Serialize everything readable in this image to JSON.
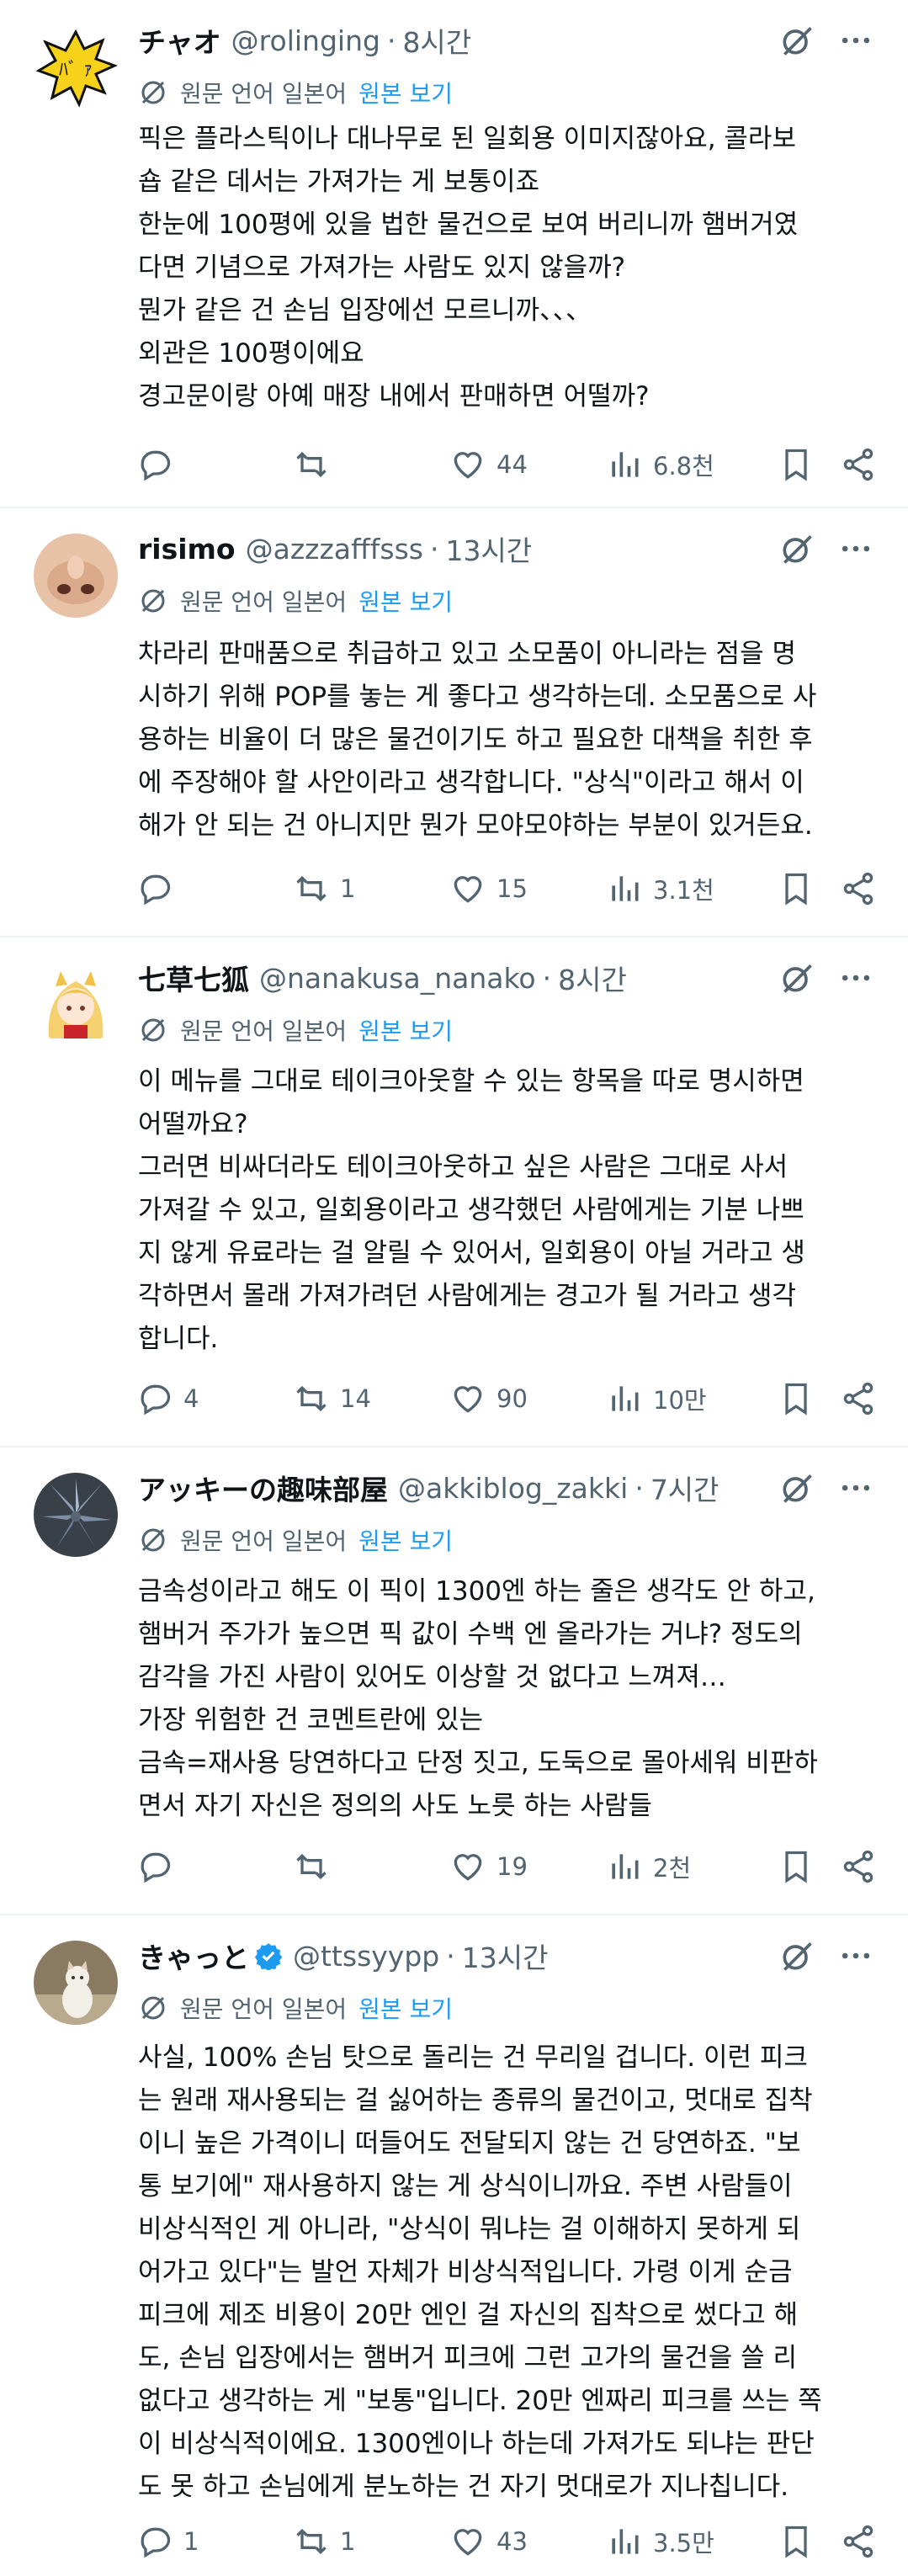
{
  "ui": {
    "translate_label": "원문 언어 일본어",
    "translate_link": "원본 보기"
  },
  "tweets": [
    {
      "name": "チャオ",
      "handle": "@rolinging",
      "dot": "·",
      "time": "8시간",
      "lines": [
        "픽은 플라스틱이나 대나무로 된 일회용 이미지잖아요, 콜라보",
        "숍 같은 데서는 가져가는 게 보통이죠",
        "한눈에 100평에 있을 법한 물건으로 보여 버리니까 햄버거였",
        "다면 기념으로 가져가는 사람도 있지 않을까?",
        "뭔가 같은 건 손님 입장에선 모르니까、、、",
        "외관은 100평이에요",
        "경고문이랑 아예 매장 내에서 판매하면 어떨까?"
      ],
      "replies": "",
      "reposts": "",
      "likes": "44",
      "views": "6.8천"
    },
    {
      "name": "risimo",
      "handle": "@azzzafffsss",
      "dot": "·",
      "time": "13시간",
      "lines": [
        "차라리 판매품으로 취급하고 있고 소모품이 아니라는 점을 명",
        "시하기 위해 POP를 놓는 게 좋다고 생각하는데. 소모품으로 사",
        "용하는 비율이 더 많은 물건이기도 하고 필요한 대책을 취한 후",
        "에 주장해야 할 사안이라고 생각합니다. \"상식\"이라고 해서 이",
        "해가 안 되는 건 아니지만 뭔가 모야모야하는 부분이 있거든요."
      ],
      "replies": "",
      "reposts": "1",
      "likes": "15",
      "views": "3.1천"
    },
    {
      "name": "七草七狐",
      "handle": "@nanakusa_nanako",
      "dot": "·",
      "time": "8시간",
      "lines": [
        "이 메뉴를 그대로 테이크아웃할 수 있는 항목을 따로 명시하면",
        "어떨까요?",
        "그러면 비싸더라도 테이크아웃하고 싶은 사람은 그대로 사서",
        "가져갈 수 있고, 일회용이라고 생각했던 사람에게는 기분 나쁘",
        "지 않게 유료라는 걸 알릴 수 있어서, 일회용이 아닐 거라고 생",
        "각하면서 몰래 가져가려던 사람에게는 경고가 될 거라고 생각",
        "합니다."
      ],
      "replies": "4",
      "reposts": "14",
      "likes": "90",
      "views": "10만"
    },
    {
      "name": "アッキーの趣味部屋",
      "handle": "@akkiblog_zakki",
      "dot": "·",
      "time": "7시간",
      "lines": [
        "금속성이라고 해도 이 픽이 1300엔 하는 줄은 생각도 안 하고,",
        "햄버거 주가가 높으면 픽 값이 수백 엔 올라가는 거냐? 정도의",
        "감각을 가진 사람이 있어도 이상할 것 없다고 느껴져…",
        "가장 위험한 건 코멘트란에 있는",
        "금속=재사용 당연하다고 단정 짓고, 도둑으로 몰아세워 비판하",
        "면서 자기 자신은 정의의 사도 노릇 하는 사람들"
      ],
      "replies": "",
      "reposts": "",
      "likes": "19",
      "views": "2천"
    },
    {
      "name": "きゃっと",
      "handle": "@ttssyypp",
      "dot": "·",
      "time": "13시간",
      "lines": [
        "사실, 100% 손님 탓으로 돌리는 건 무리일 겁니다. 이런 피크",
        "는 원래 재사용되는 걸 싫어하는 종류의 물건이고, 멋대로 집착",
        "이니 높은 가격이니 떠들어도 전달되지 않는 건 당연하죠. \"보",
        "통 보기에\" 재사용하지 않는 게 상식이니까요. 주변 사람들이",
        "비상식적인 게 아니라, \"상식이 뭐냐는 걸 이해하지 못하게 되",
        "어가고 있다\"는 발언 자체가 비상식적입니다. 가령 이게 순금",
        "피크에 제조 비용이 20만 엔인 걸 자신의 집착으로 썼다고 해",
        "도, 손님 입장에서는 햄버거 피크에 그런 고가의 물건을 쓸 리",
        "없다고 생각하는 게 \"보통\"입니다. 20만 엔짜리 피크를 쓰는 쪽",
        "이 비상식적이에요. 1300엔이나 하는데 가져가도 되냐는 판단",
        "도 못 하고 손님에게 분노하는 건 자기 멋대로가 지나칩니다."
      ],
      "replies": "1",
      "reposts": "1",
      "likes": "43",
      "views": "3.5만"
    }
  ]
}
